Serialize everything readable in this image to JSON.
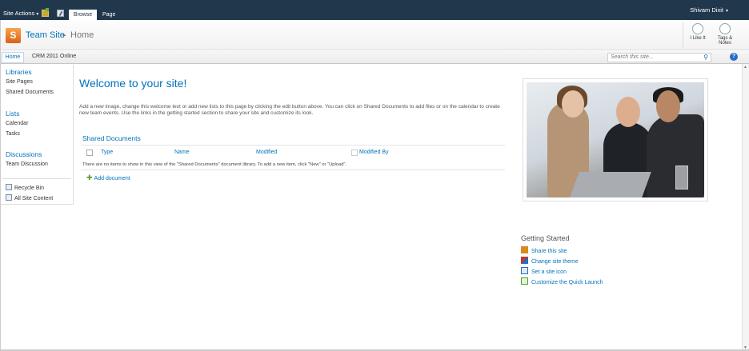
{
  "ribbon": {
    "site_actions": "Site Actions",
    "site_actions_caret": "▾",
    "tabs": [
      "Browse",
      "Page"
    ],
    "user": "Shivam Dixit",
    "user_caret": "▾"
  },
  "title_area": {
    "logo_letter": "S",
    "site_title": "Team Site",
    "crumb_separator": "▸",
    "page": "Home",
    "social": [
      {
        "label": "I Like It",
        "icon": "thumbs-up-icon"
      },
      {
        "label": "Tags & Notes",
        "icon": "tag-icon"
      }
    ]
  },
  "topnav": {
    "items": [
      "Home",
      "CRM 2011 Online"
    ],
    "search_placeholder": "Search this site...",
    "search_icon": "⚲",
    "help_icon": "?"
  },
  "quicklaunch": {
    "libraries": {
      "heading": "Libraries",
      "items": [
        "Site Pages",
        "Shared Documents"
      ]
    },
    "lists": {
      "heading": "Lists",
      "items": [
        "Calendar",
        "Tasks"
      ]
    },
    "discussions": {
      "heading": "Discussions",
      "items": [
        "Team Discussion"
      ]
    },
    "utility": [
      "Recycle Bin",
      "All Site Content"
    ]
  },
  "main": {
    "welcome": "Welcome to your site!",
    "intro": "Add a new image, change this welcome text or add new lists to this page by clicking the edit button above. You can click on Shared Documents to add files or on the calendar to create new team events. Use the links in the getting started section to share your site and customize its look.",
    "shared_docs": {
      "title": "Shared Documents",
      "columns": [
        "Type",
        "Name",
        "Modified",
        "Modified By"
      ],
      "empty_message": "There are no items to show in this view of the \"Shared Documents\" document library. To add a new item, click \"New\" or \"Upload\".",
      "add_label": "Add document",
      "add_icon": "✚"
    }
  },
  "getting_started": {
    "title": "Getting Started",
    "items": [
      "Share this site",
      "Change site theme",
      "Set a site icon",
      "Customize the Quick Launch"
    ],
    "icon_colors": [
      "#d98b1e",
      "#c0392b",
      "#2a6cc2",
      "#4ea126"
    ]
  },
  "scrollbar": {
    "up": "▲",
    "down": "▼"
  }
}
